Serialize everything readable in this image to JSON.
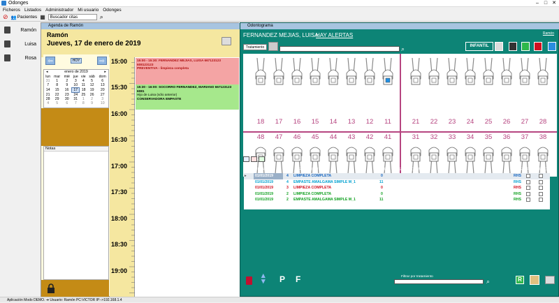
{
  "window": {
    "title": "Odonges"
  },
  "menu": [
    "Ficheros",
    "Listados",
    "Administrador",
    "Mi usuario",
    "Odonges"
  ],
  "toolbar": {
    "pacientes_label": "Pacientes",
    "search_value": "Buscador citas"
  },
  "doctors": [
    "Ramón",
    "Luisa",
    "Rosa"
  ],
  "agenda": {
    "title": "Agenda de Ramón",
    "doctor": "Ramón",
    "date": "Jueves, 17 de enero de 2019",
    "hoy": "HOY",
    "month_label": "enero de 2019",
    "weekdays": [
      "lun",
      "mar",
      "mié",
      "jue",
      "vie",
      "sáb",
      "dom"
    ],
    "weeks": [
      [
        "31",
        "1",
        "2",
        "3",
        "4",
        "5",
        "6"
      ],
      [
        "7",
        "8",
        "9",
        "10",
        "11",
        "12",
        "13"
      ],
      [
        "14",
        "15",
        "16",
        "17",
        "18",
        "19",
        "20"
      ],
      [
        "21",
        "22",
        "23",
        "24",
        "25",
        "26",
        "27"
      ],
      [
        "28",
        "29",
        "30",
        "31",
        "1",
        "2",
        "3"
      ],
      [
        "4",
        "5",
        "6",
        "7",
        "8",
        "9",
        "10"
      ]
    ],
    "notas_label": "Notas",
    "times": [
      "15:00",
      "15:30",
      "16:00",
      "16:30",
      "17:00",
      "17:30",
      "18:00",
      "18:30",
      "19:00"
    ],
    "appointments": [
      {
        "line1": "15:00 - 15:30: FERNANDEZ MEJIAS, LUISA 667123123 608123123",
        "line2": "PREVENTIVA - limpieza completa",
        "color": "#f4a4a4"
      },
      {
        "line1": "15:30 - 16:00: SOCORRO FERNANDEZ, MARIANO 667123123 6081",
        "line2": "Hijo de Luisa (sólo anterior)",
        "line3": "CONSERVADORA EMPASTE",
        "color": "#a6e88c"
      }
    ]
  },
  "odontograma": {
    "title": "Odontograma",
    "patient": "FERNANDEZ MEJIAS, LUISA",
    "alert": "HAY ALERTAS",
    "user": "Ramón",
    "tratamiento_btn": "Tratamiento",
    "infantil": "INFANTIL",
    "upper_teeth": [
      "18",
      "17",
      "16",
      "15",
      "14",
      "13",
      "12",
      "11",
      "21",
      "22",
      "23",
      "24",
      "25",
      "26",
      "27",
      "28"
    ],
    "lower_teeth": [
      "48",
      "47",
      "46",
      "45",
      "44",
      "43",
      "42",
      "41",
      "31",
      "32",
      "33",
      "34",
      "35",
      "36",
      "37",
      "38"
    ],
    "columns": [
      "FECHA",
      "P",
      "TRATAMIENTO",
      "P",
      "OBSERVACIONES",
      "GPE",
      "PRE",
      "FAC"
    ],
    "rows": [
      {
        "fecha": "01/01/2019",
        "p": "4",
        "trat": "LIMPIEZA COMPLETA",
        "pz": "0",
        "gpe": "RHS",
        "color": "#1565c0",
        "sel": true
      },
      {
        "fecha": "01/01/2019",
        "p": "4",
        "trat": "EMPASTE AMALGAMA SIMPLE M_1",
        "pz": "11",
        "gpe": "RHS",
        "color": "#00a0d0"
      },
      {
        "fecha": "01/01/2019",
        "p": "3",
        "trat": "LIMPIEZA COMPLETA",
        "pz": "0",
        "gpe": "RHS",
        "color": "#d01020"
      },
      {
        "fecha": "01/01/2019",
        "p": "2",
        "trat": "LIMPIEZA COMPLETA",
        "pz": "0",
        "gpe": "RHS",
        "color": "#10a020"
      },
      {
        "fecha": "01/01/2019",
        "p": "2",
        "trat": "EMPASTE AMALGAMA SIMPLE M_1",
        "pz": "11",
        "gpe": "RHS",
        "color": "#10a020"
      }
    ],
    "filter_label": "Filtrar por tratamiento",
    "r_label": "R",
    "p_label": "P",
    "f_label": "F"
  },
  "status": "Aplicación Modo DEMO. ➔ Usuario: Ramón  PC:VICTOR IP:->192.168.1.4",
  "colors": {
    "teal": "#0d8476",
    "yellow": "#f5e7a0",
    "tooth_number": "#b64580"
  }
}
